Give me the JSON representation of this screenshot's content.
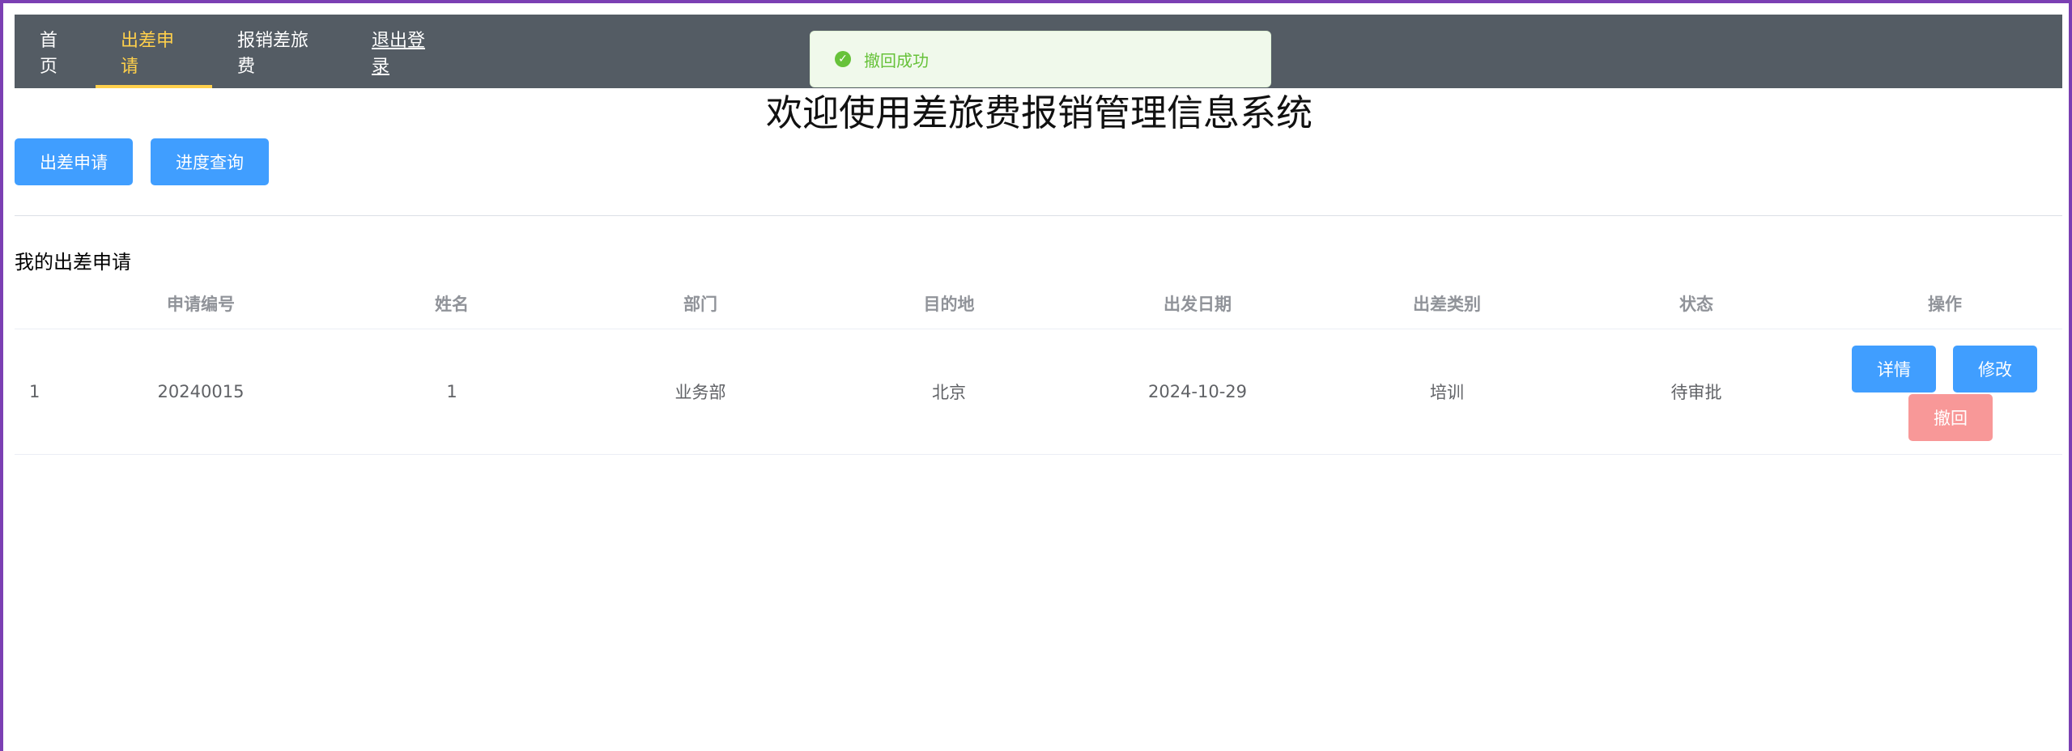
{
  "nav": {
    "items": [
      {
        "label": "首页"
      },
      {
        "label": "出差申请"
      },
      {
        "label": "报销差旅费"
      },
      {
        "label": "退出登录"
      }
    ]
  },
  "toast": {
    "message": "撤回成功",
    "icon": "check-circle-icon",
    "color": "#67c23a"
  },
  "page": {
    "title": "欢迎使用差旅费报销管理信息系统"
  },
  "actions": {
    "apply_label": "出差申请",
    "progress_label": "进度查询"
  },
  "section": {
    "title": "我的出差申请"
  },
  "table": {
    "headers": [
      "申请编号",
      "姓名",
      "部门",
      "目的地",
      "出发日期",
      "出差类别",
      "状态",
      "操作"
    ],
    "rows": [
      {
        "index": "1",
        "cells": [
          "20240015",
          "1",
          "业务部",
          "北京",
          "2024-10-29",
          "培训",
          "待审批"
        ],
        "ops": {
          "detail": "详情",
          "edit": "修改",
          "withdraw": "撤回"
        }
      }
    ]
  },
  "colors": {
    "nav_bg": "#545c64",
    "nav_active": "#ffd04b",
    "primary": "#409eff",
    "danger": "#f89898"
  }
}
